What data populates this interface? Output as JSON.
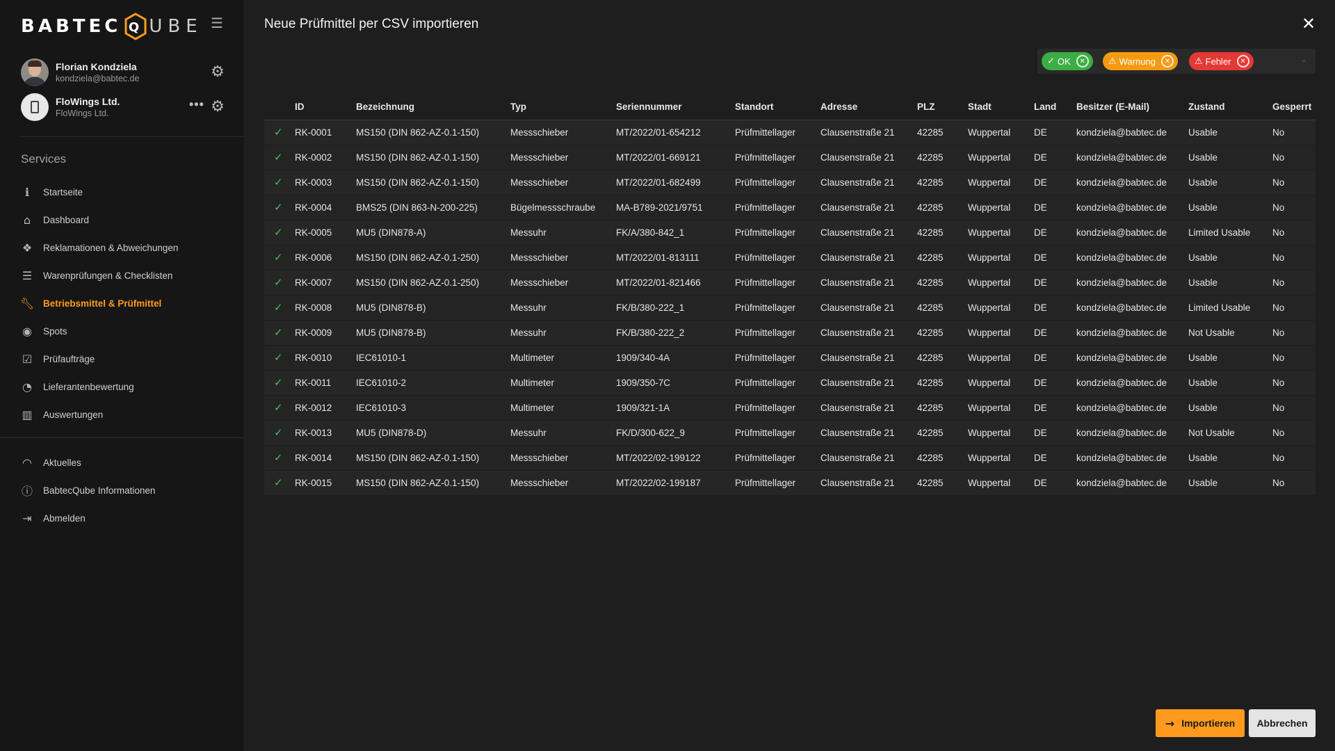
{
  "sidebar": {
    "logo_left": "BABTEC",
    "logo_q": "Q",
    "logo_right": "UBE",
    "user": {
      "name": "Florian Kondziela",
      "email": "kondziela@babtec.de"
    },
    "org": {
      "name": "FloWings Ltd.",
      "sub": "FloWings Ltd."
    },
    "section_title": "Services",
    "items": [
      {
        "label": "Startseite",
        "icon": "info-icon"
      },
      {
        "label": "Dashboard",
        "icon": "home-icon"
      },
      {
        "label": "Reklamationen & Abweichungen",
        "icon": "boxes-icon"
      },
      {
        "label": "Warenprüfungen & Checklisten",
        "icon": "list-icon"
      },
      {
        "label": "Betriebsmittel & Prüfmittel",
        "icon": "wrench-icon",
        "active": true
      },
      {
        "label": "Spots",
        "icon": "target-icon"
      },
      {
        "label": "Prüfaufträge",
        "icon": "check-square-icon"
      },
      {
        "label": "Lieferantenbewertung",
        "icon": "gauge-icon"
      },
      {
        "label": "Auswertungen",
        "icon": "bar-chart-icon"
      }
    ],
    "items2": [
      {
        "label": "Aktuelles",
        "icon": "rss-icon"
      },
      {
        "label": "BabtecQube Informationen",
        "icon": "info-circle-icon"
      },
      {
        "label": "Abmelden",
        "icon": "logout-icon"
      }
    ]
  },
  "dialog": {
    "title": "Neue Prüfmittel per CSV importieren",
    "filters": {
      "ok": "OK",
      "warn": "Warnung",
      "err": "Fehler"
    },
    "columns": [
      "ID",
      "Bezeichnung",
      "Typ",
      "Seriennummer",
      "Standort",
      "Adresse",
      "PLZ",
      "Stadt",
      "Land",
      "Besitzer (E-Mail)",
      "Zustand",
      "Gesperrt"
    ],
    "rows": [
      [
        "RK-0001",
        "MS150 (DIN 862-AZ-0.1-150)",
        "Messschieber",
        "MT/2022/01-654212",
        "Prüfmittellager",
        "Clausenstraße 21",
        "42285",
        "Wuppertal",
        "DE",
        "kondziela@babtec.de",
        "Usable",
        "No"
      ],
      [
        "RK-0002",
        "MS150 (DIN 862-AZ-0.1-150)",
        "Messschieber",
        "MT/2022/01-669121",
        "Prüfmittellager",
        "Clausenstraße 21",
        "42285",
        "Wuppertal",
        "DE",
        "kondziela@babtec.de",
        "Usable",
        "No"
      ],
      [
        "RK-0003",
        "MS150 (DIN 862-AZ-0.1-150)",
        "Messschieber",
        "MT/2022/01-682499",
        "Prüfmittellager",
        "Clausenstraße 21",
        "42285",
        "Wuppertal",
        "DE",
        "kondziela@babtec.de",
        "Usable",
        "No"
      ],
      [
        "RK-0004",
        "BMS25 (DIN 863-N-200-225)",
        "Bügelmessschraube",
        "MA-B789-2021/9751",
        "Prüfmittellager",
        "Clausenstraße 21",
        "42285",
        "Wuppertal",
        "DE",
        "kondziela@babtec.de",
        "Usable",
        "No"
      ],
      [
        "RK-0005",
        "MU5 (DIN878-A)",
        "Messuhr",
        "FK/A/380-842_1",
        "Prüfmittellager",
        "Clausenstraße 21",
        "42285",
        "Wuppertal",
        "DE",
        "kondziela@babtec.de",
        "Limited Usable",
        "No"
      ],
      [
        "RK-0006",
        "MS150 (DIN 862-AZ-0.1-250)",
        "Messschieber",
        "MT/2022/01-813111",
        "Prüfmittellager",
        "Clausenstraße 21",
        "42285",
        "Wuppertal",
        "DE",
        "kondziela@babtec.de",
        "Usable",
        "No"
      ],
      [
        "RK-0007",
        "MS150 (DIN 862-AZ-0.1-250)",
        "Messschieber",
        "MT/2022/01-821466",
        "Prüfmittellager",
        "Clausenstraße 21",
        "42285",
        "Wuppertal",
        "DE",
        "kondziela@babtec.de",
        "Usable",
        "No"
      ],
      [
        "RK-0008",
        "MU5 (DIN878-B)",
        "Messuhr",
        "FK/B/380-222_1",
        "Prüfmittellager",
        "Clausenstraße 21",
        "42285",
        "Wuppertal",
        "DE",
        "kondziela@babtec.de",
        "Limited Usable",
        "No"
      ],
      [
        "RK-0009",
        "MU5 (DIN878-B)",
        "Messuhr",
        "FK/B/380-222_2",
        "Prüfmittellager",
        "Clausenstraße 21",
        "42285",
        "Wuppertal",
        "DE",
        "kondziela@babtec.de",
        "Not Usable",
        "No"
      ],
      [
        "RK-0010",
        "IEC61010-1",
        "Multimeter",
        "1909/340-4A",
        "Prüfmittellager",
        "Clausenstraße 21",
        "42285",
        "Wuppertal",
        "DE",
        "kondziela@babtec.de",
        "Usable",
        "No"
      ],
      [
        "RK-0011",
        "IEC61010-2",
        "Multimeter",
        "1909/350-7C",
        "Prüfmittellager",
        "Clausenstraße 21",
        "42285",
        "Wuppertal",
        "DE",
        "kondziela@babtec.de",
        "Usable",
        "No"
      ],
      [
        "RK-0012",
        "IEC61010-3",
        "Multimeter",
        "1909/321-1A",
        "Prüfmittellager",
        "Clausenstraße 21",
        "42285",
        "Wuppertal",
        "DE",
        "kondziela@babtec.de",
        "Usable",
        "No"
      ],
      [
        "RK-0013",
        "MU5 (DIN878-D)",
        "Messuhr",
        "FK/D/300-622_9",
        "Prüfmittellager",
        "Clausenstraße 21",
        "42285",
        "Wuppertal",
        "DE",
        "kondziela@babtec.de",
        "Not Usable",
        "No"
      ],
      [
        "RK-0014",
        "MS150 (DIN 862-AZ-0.1-150)",
        "Messschieber",
        "MT/2022/02-199122",
        "Prüfmittellager",
        "Clausenstraße 21",
        "42285",
        "Wuppertal",
        "DE",
        "kondziela@babtec.de",
        "Usable",
        "No"
      ],
      [
        "RK-0015",
        "MS150 (DIN 862-AZ-0.1-150)",
        "Messschieber",
        "MT/2022/02-199187",
        "Prüfmittellager",
        "Clausenstraße 21",
        "42285",
        "Wuppertal",
        "DE",
        "kondziela@babtec.de",
        "Usable",
        "No"
      ]
    ],
    "import_label": "Importieren",
    "cancel_label": "Abbrechen"
  },
  "colors": {
    "accent": "#ff9a1f",
    "ok": "#3cae45",
    "warn": "#f49b12",
    "err": "#e53935"
  }
}
